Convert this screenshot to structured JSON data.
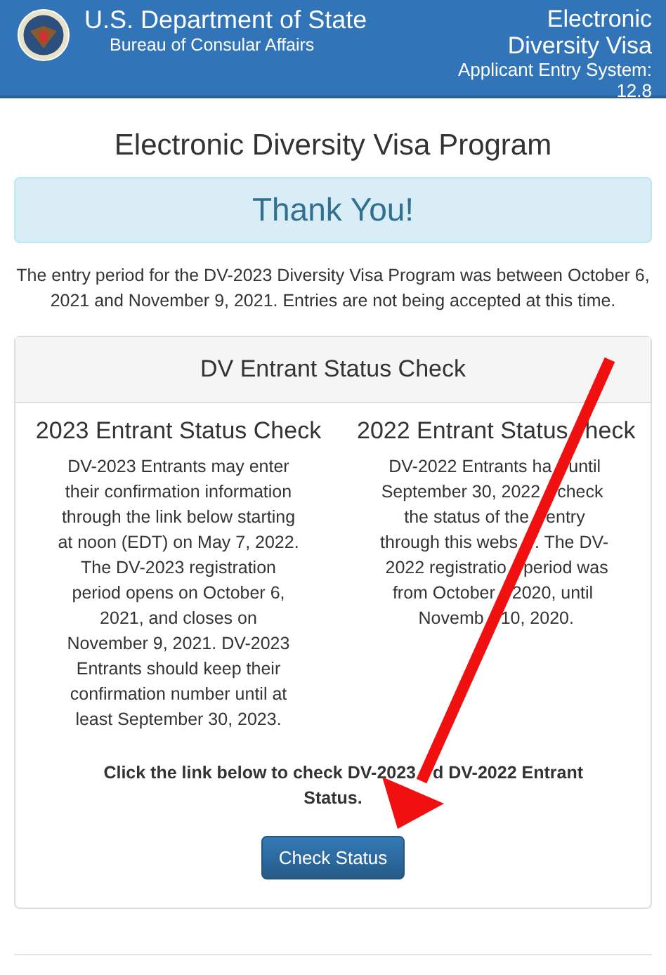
{
  "header": {
    "agency": "U.S. Department of State",
    "bureau": "Bureau of Consular Affairs",
    "system_lines": [
      "Electronic",
      "Diversity Visa"
    ],
    "system_sub": "Applicant Entry System:",
    "version": "12.8"
  },
  "page_title": "Electronic Diversity Visa Program",
  "banner": "Thank You!",
  "notice": "The entry period for the DV-2023 Diversity Visa Program was between October 6, 2021 and November 9, 2021. Entries are not being accepted at this time.",
  "card": {
    "title": "DV Entrant Status Check",
    "columns": [
      {
        "heading": "2023 Entrant Status Check",
        "body": "DV-2023 Entrants may enter their confirmation information through the link below starting at noon (EDT) on May 7, 2022. The DV-2023 registration period opens on October 6, 2021, and closes on November 9, 2021. DV-2023 Entrants should keep their confirmation number until at least September 30, 2023."
      },
      {
        "heading_parts": [
          "2022 Entrant Status",
          "heck"
        ],
        "lines": [
          [
            "DV-2022 Entrants ha",
            "until"
          ],
          [
            "September 30, 2022",
            "check"
          ],
          [
            "the status of the",
            "entry"
          ],
          [
            "through this webs",
            ". The DV-"
          ],
          [
            "2022 registratio",
            "period was"
          ],
          [
            "from October",
            "2020, until"
          ],
          [
            "Novemb",
            "10, 2020."
          ]
        ]
      }
    ],
    "instruction": [
      [
        "Click the link below to check DV-2023",
        "d DV-2022 Entrant"
      ],
      [
        "Status."
      ]
    ],
    "button": "Check Status"
  }
}
